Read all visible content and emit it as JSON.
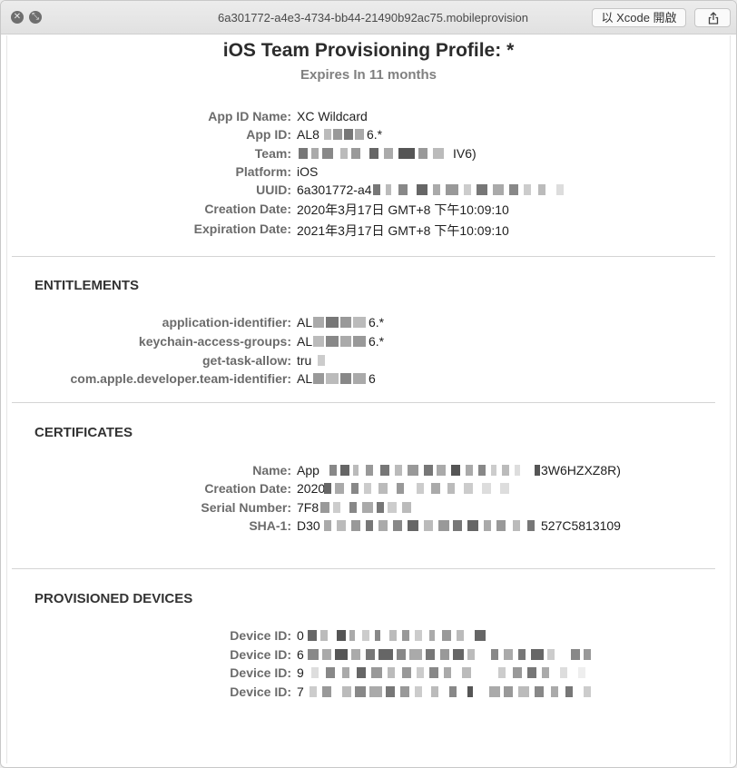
{
  "window": {
    "title": "6a301772-a4e3-4734-bb44-21490b92ac75.mobileprovision",
    "open_button": "以 Xcode 開啟"
  },
  "header": {
    "title": "iOS Team Provisioning Profile: *",
    "subtitle": "Expires In 11 months"
  },
  "info": [
    {
      "label": "App ID Name:",
      "value": "XC Wildcard"
    },
    {
      "label": "App ID:",
      "value": "AL8",
      "suffix": "6.*"
    },
    {
      "label": "Team:",
      "value": "",
      "suffix": "IV6)"
    },
    {
      "label": "Platform:",
      "value": "iOS"
    },
    {
      "label": "UUID:",
      "value": "6a301772-a4"
    },
    {
      "label": "Creation Date:",
      "value": "2020年3月17日 GMT+8 下午10:09:10"
    },
    {
      "label": "Expiration Date:",
      "value": "2021年3月17日 GMT+8 下午10:09:10"
    }
  ],
  "entitlements": {
    "heading": "ENTITLEMENTS",
    "items": [
      {
        "label": "application-identifier:",
        "value": "AL",
        "suffix": "6.*"
      },
      {
        "label": "keychain-access-groups:",
        "value": "AL",
        "suffix": "6.*"
      },
      {
        "label": "get-task-allow:",
        "value": "tru",
        "suffix": ""
      },
      {
        "label": "com.apple.developer.team-identifier:",
        "value": "AL",
        "suffix": "6"
      }
    ]
  },
  "certificates": {
    "heading": "CERTIFICATES",
    "items": [
      {
        "label": "Name:",
        "value": "App",
        "suffix": "3W6HZXZ8R)"
      },
      {
        "label": "Creation Date:",
        "value": "2020",
        "suffix": ""
      },
      {
        "label": "Serial Number:",
        "value": "7F8",
        "suffix": ""
      },
      {
        "label": "SHA-1:",
        "value": "D30",
        "suffix": "527C5813109"
      }
    ]
  },
  "devices": {
    "heading": "PROVISIONED DEVICES",
    "items": [
      {
        "label": "Device ID:",
        "value": "0"
      },
      {
        "label": "Device ID:",
        "value": "6"
      },
      {
        "label": "Device ID:",
        "value": "9"
      },
      {
        "label": "Device ID:",
        "value": "7"
      }
    ]
  }
}
